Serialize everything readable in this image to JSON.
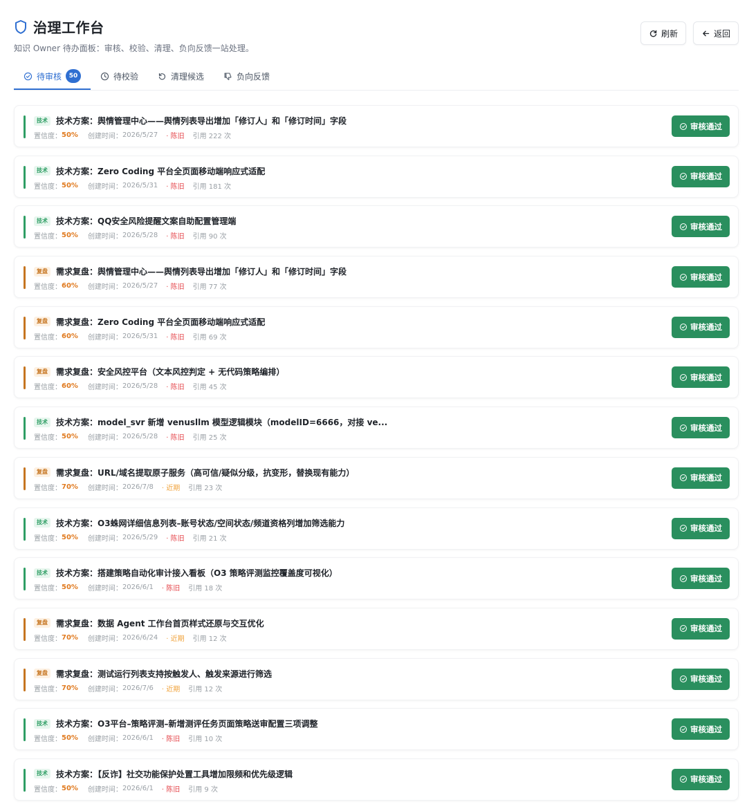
{
  "header": {
    "title": "治理工作台",
    "subtitle": "知识 Owner 待办面板：审核、校验、清理、负向反馈一站处理。",
    "refresh_label": "刷新",
    "back_label": "返回"
  },
  "tabs": [
    {
      "label": "待审核",
      "badge": "50",
      "icon": "check-circle-icon",
      "active": true
    },
    {
      "label": "待校验",
      "icon": "clock-icon"
    },
    {
      "label": "清理候选",
      "icon": "rotate-ccw-icon"
    },
    {
      "label": "负向反馈",
      "icon": "thumbs-down-icon"
    }
  ],
  "labels": {
    "confidence": "置信度：",
    "created": "创建时间：",
    "approve": "审核通过"
  },
  "colors": {
    "accent": "#2f6fd1",
    "approve_button": "#2a8f5e",
    "tech_bar": "#2e9e64",
    "review_bar": "#c67520",
    "stale": "#e5484d",
    "recent": "#f0a33c"
  },
  "items": [
    {
      "type": "tech",
      "tag": "技术",
      "title": "技术方案：舆情管理中心——舆情列表导出增加「修订人」和「修订时间」字段",
      "confidence": "50%",
      "created": "2026/5/27",
      "freshness": "陈旧",
      "freshness_type": "stale",
      "citations": "引用 222 次"
    },
    {
      "type": "tech",
      "tag": "技术",
      "title": "技术方案：Zero Coding 平台全页面移动端响应式适配",
      "confidence": "50%",
      "created": "2026/5/31",
      "freshness": "陈旧",
      "freshness_type": "stale",
      "citations": "引用 181 次"
    },
    {
      "type": "tech",
      "tag": "技术",
      "title": "技术方案：QQ安全风险提醒文案自助配置管理端",
      "confidence": "50%",
      "created": "2026/5/28",
      "freshness": "陈旧",
      "freshness_type": "stale",
      "citations": "引用 90 次"
    },
    {
      "type": "review",
      "tag": "复盘",
      "title": "需求复盘：舆情管理中心——舆情列表导出增加「修订人」和「修订时间」字段",
      "confidence": "60%",
      "created": "2026/5/27",
      "freshness": "陈旧",
      "freshness_type": "stale",
      "citations": "引用 77 次"
    },
    {
      "type": "review",
      "tag": "复盘",
      "title": "需求复盘：Zero Coding 平台全页面移动端响应式适配",
      "confidence": "60%",
      "created": "2026/5/31",
      "freshness": "陈旧",
      "freshness_type": "stale",
      "citations": "引用 69 次"
    },
    {
      "type": "review",
      "tag": "复盘",
      "title": "需求复盘：安全风控平台（文本风控判定 + 无代码策略编排）",
      "confidence": "60%",
      "created": "2026/5/28",
      "freshness": "陈旧",
      "freshness_type": "stale",
      "citations": "引用 45 次"
    },
    {
      "type": "tech",
      "tag": "技术",
      "title": "技术方案：model_svr 新增 venusllm 模型逻辑模块（modelID=6666，对接 ve...",
      "confidence": "50%",
      "created": "2026/5/28",
      "freshness": "陈旧",
      "freshness_type": "stale",
      "citations": "引用 25 次"
    },
    {
      "type": "review",
      "tag": "复盘",
      "title": "需求复盘：URL/域名提取原子服务（高可信/疑似分级，抗变形，替换现有能力）",
      "confidence": "70%",
      "created": "2026/7/8",
      "freshness": "近期",
      "freshness_type": "recent",
      "citations": "引用 23 次"
    },
    {
      "type": "tech",
      "tag": "技术",
      "title": "技术方案：O3蛛网详细信息列表–账号状态/空间状态/频道资格列增加筛选能力",
      "confidence": "50%",
      "created": "2026/5/29",
      "freshness": "陈旧",
      "freshness_type": "stale",
      "citations": "引用 21 次"
    },
    {
      "type": "tech",
      "tag": "技术",
      "title": "技术方案：搭建策略自动化审计接入看板（O3 策略评测监控覆盖度可视化）",
      "confidence": "50%",
      "created": "2026/6/1",
      "freshness": "陈旧",
      "freshness_type": "stale",
      "citations": "引用 18 次"
    },
    {
      "type": "review",
      "tag": "复盘",
      "title": "需求复盘：数据 Agent 工作台首页样式还原与交互优化",
      "confidence": "70%",
      "created": "2026/6/24",
      "freshness": "近期",
      "freshness_type": "recent",
      "citations": "引用 12 次"
    },
    {
      "type": "review",
      "tag": "复盘",
      "title": "需求复盘：测试运行列表支持按触发人、触发来源进行筛选",
      "confidence": "70%",
      "created": "2026/7/6",
      "freshness": "近期",
      "freshness_type": "recent",
      "citations": "引用 12 次"
    },
    {
      "type": "tech",
      "tag": "技术",
      "title": "技术方案：O3平台–策略评测–新增测评任务页面策略送审配置三项调整",
      "confidence": "50%",
      "created": "2026/6/1",
      "freshness": "陈旧",
      "freshness_type": "stale",
      "citations": "引用 10 次"
    },
    {
      "type": "tech",
      "tag": "技术",
      "title": "技术方案：【反诈】社交功能保护处置工具增加限频和优先级逻辑",
      "confidence": "50%",
      "created": "2026/6/1",
      "freshness": "陈旧",
      "freshness_type": "stale",
      "citations": "引用 9 次"
    }
  ]
}
